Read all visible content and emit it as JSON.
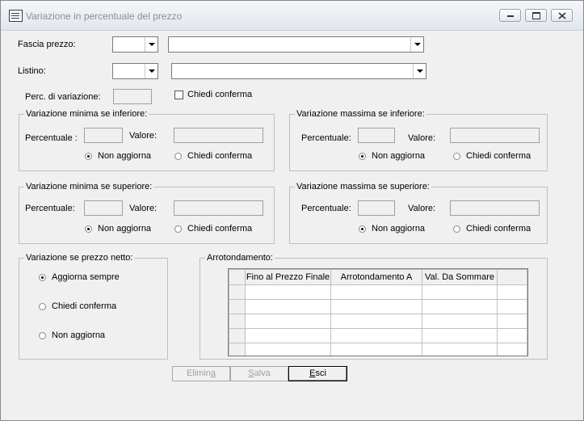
{
  "window": {
    "title": "Variazione in percentuale del prezzo",
    "controls": [
      "minimize",
      "restore",
      "close"
    ]
  },
  "fascia_prezzo": {
    "label": "Fascia prezzo:",
    "code_value": "",
    "description_value": ""
  },
  "listino": {
    "label": "Listino:",
    "code_value": "",
    "description_value": ""
  },
  "perc_variazione": {
    "label": "Perc. di variazione:",
    "value": "",
    "chiedi_conferma_label": "Chiedi conferma",
    "chiedi_conferma_checked": false
  },
  "groups": {
    "min_inferiore": {
      "title": "Variazione minima se inferiore:",
      "percentuale_label": "Percentuale :",
      "valore_label": "Valore:",
      "options": [
        "Non aggiorna",
        "Chiedi conferma"
      ],
      "selected": "Non aggiorna"
    },
    "max_inferiore": {
      "title": "Variazione massima se inferiore:",
      "percentuale_label": "Percentuale:",
      "valore_label": "Valore:",
      "options": [
        "Non aggiorna",
        "Chiedi conferma"
      ],
      "selected": "Non aggiorna"
    },
    "min_superiore": {
      "title": "Variazione minima se superiore:",
      "percentuale_label": "Percentuale:",
      "valore_label": "Valore:",
      "options": [
        "Non aggiorna",
        "Chiedi conferma"
      ],
      "selected": "Non aggiorna"
    },
    "max_superiore": {
      "title": "Variazione massima se superiore:",
      "percentuale_label": "Percentuale:",
      "valore_label": "Valore:",
      "options": [
        "Non aggiorna",
        "Chiedi conferma"
      ],
      "selected": "Non aggiorna"
    },
    "prezzo_netto": {
      "title": "Variazione se prezzo netto:",
      "options": [
        "Aggiorna sempre",
        "Chiedi conferma",
        "Non aggiorna"
      ],
      "selected": "Aggiorna sempre"
    },
    "arrotondamento": {
      "title": "Arrotondamento:",
      "columns": [
        "Fino al Prezzo Finale",
        "Arrotondamento  A",
        "Val. Da Sommare"
      ],
      "rows": [
        [
          "",
          "",
          ""
        ],
        [
          "",
          "",
          ""
        ],
        [
          "",
          "",
          ""
        ],
        [
          "",
          "",
          ""
        ],
        [
          "",
          "",
          ""
        ]
      ]
    }
  },
  "buttons": {
    "elimina": {
      "label_pre": "Elimin",
      "label_ul": "a",
      "label_post": "",
      "enabled": false
    },
    "salva": {
      "label_pre": "",
      "label_ul": "S",
      "label_post": "alva",
      "enabled": false
    },
    "esci": {
      "label_pre": "",
      "label_ul": "E",
      "label_post": "sci",
      "enabled": true
    }
  },
  "icons": {
    "app": "form-icon",
    "combo_arrow": "chevron-down-icon",
    "minimize": "minimize-icon",
    "restore": "restore-icon",
    "close": "close-icon"
  }
}
